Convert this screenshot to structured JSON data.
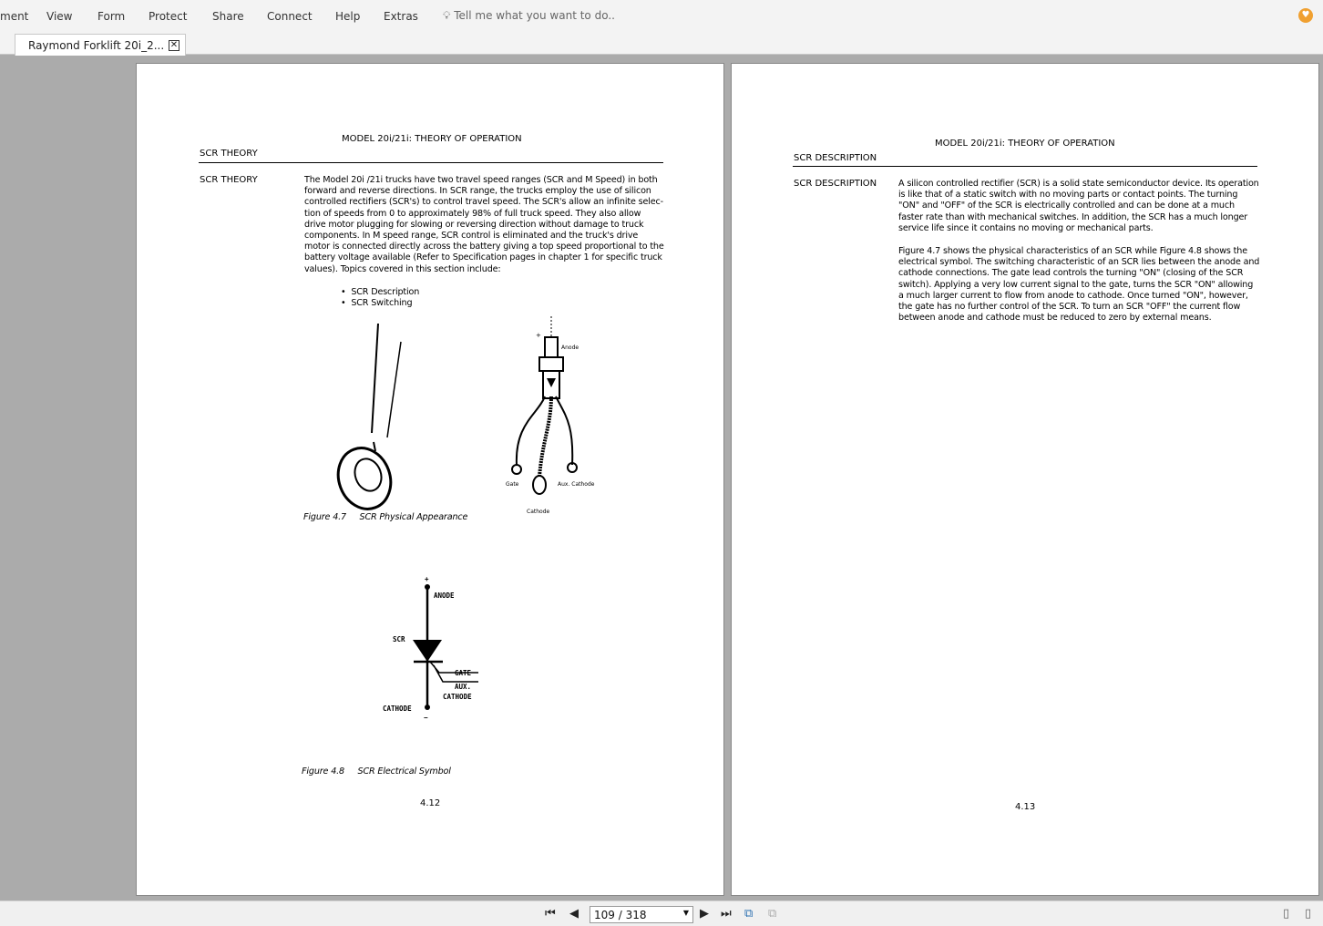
{
  "menu": [
    "ment",
    "View",
    "Form",
    "Protect",
    "Share",
    "Connect",
    "Help",
    "Extras"
  ],
  "tell_me": "Tell me what you want to do..",
  "tab": {
    "title": "Raymond Forklift 20i_2..."
  },
  "left_page": {
    "header": "MODEL 20i/21i: THEORY OF OPERATION",
    "section": "SCR THEORY",
    "side_label": "SCR THEORY",
    "body_lines": [
      "The Model 20i /21i trucks have two travel speed ranges (SCR and M Speed) in both",
      "forward and reverse directions. In SCR range, the trucks employ the use of silicon",
      "controlled rectifiers (SCR's) to control travel speed. The SCR's allow an infinite selec-",
      "tion of speeds from 0 to approximately 98% of full truck speed. They also allow",
      "drive motor plugging for slowing or reversing direction without damage to truck",
      "components. In M speed range, SCR control is eliminated and the truck's drive",
      "motor is connected directly across the battery giving a top speed proportional to the",
      "battery voltage available (Refer to Specification pages in chapter 1 for specific truck",
      "values). Topics covered in this section include:"
    ],
    "bullets": [
      "SCR  Description",
      "SCR  Switching"
    ],
    "fig47_labels": {
      "plus": "+",
      "anode": "Anode",
      "gate": "Gate",
      "aux": "Aux. Cathode",
      "cathode": "Cathode"
    },
    "fig47_caption_num": "Figure 4.7",
    "fig47_caption": "SCR Physical Appearance",
    "fig48_labels": {
      "plus": "+",
      "anode": "ANODE",
      "scr": "SCR",
      "gate": "GATE",
      "aux": "AUX.",
      "cathode2": "CATHODE",
      "cathode": "CATHODE",
      "minus": "−"
    },
    "fig48_caption_num": "Figure 4.8",
    "fig48_caption": "SCR Electrical Symbol",
    "page_number": "4.12"
  },
  "right_page": {
    "header": "MODEL 20i/21i: THEORY OF OPERATION",
    "section": "SCR  DESCRIPTION",
    "side_label": "SCR  DESCRIPTION",
    "para1_lines": [
      "A silicon controlled rectifier (SCR) is a solid state semiconductor device. Its operation",
      "is like that of a static switch with no moving parts or contact points. The turning",
      "\"ON\" and \"OFF\" of the SCR is electrically controlled and can be done at a much",
      "faster rate than with mechanical switches. In addition, the SCR has a much longer",
      "service life since it contains no moving or mechanical parts."
    ],
    "para2_lines": [
      "Figure 4.7 shows the physical characteristics of an SCR while Figure 4.8 shows the",
      "electrical symbol. The switching characteristic of an SCR lies between the anode and",
      "cathode connections. The gate lead controls the turning \"ON\" (closing of the SCR",
      "switch). Applying a very low current signal to the gate, turns the SCR \"ON\" allowing",
      "a much larger current to flow from anode to cathode. Once turned \"ON\", however,",
      "the gate has no further control of the SCR.  To turn an SCR \"OFF\" the current flow",
      "between anode and cathode must be reduced to zero by external means."
    ],
    "page_number": "4.13"
  },
  "navigation": {
    "page_display": "109 / 318"
  }
}
